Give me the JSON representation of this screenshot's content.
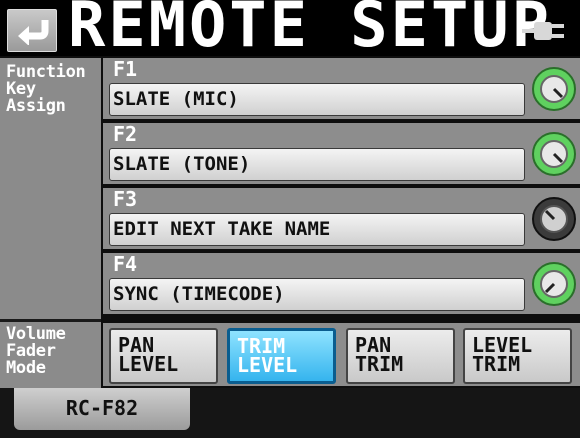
{
  "header": {
    "title": "REMOTE SETUP"
  },
  "function_key_section": {
    "label_lines": [
      "Function",
      "Key",
      "Assign"
    ],
    "keys": [
      {
        "key": "F1",
        "value": "SLATE (MIC)",
        "knob_color": "#5fd15f"
      },
      {
        "key": "F2",
        "value": "SLATE (TONE)",
        "knob_color": "#5fd15f"
      },
      {
        "key": "F3",
        "value": "EDIT NEXT TAKE NAME",
        "knob_color": "#3b3b3b"
      },
      {
        "key": "F4",
        "value": "SYNC (TIMECODE)",
        "knob_color": "#5fd15f"
      }
    ]
  },
  "volume_fader_section": {
    "label_lines": [
      "Volume",
      "Fader",
      "Mode"
    ],
    "buttons": [
      {
        "line1": "PAN",
        "line2": "LEVEL",
        "selected": false
      },
      {
        "line1": "TRIM",
        "line2": "LEVEL",
        "selected": true
      },
      {
        "line1": "PAN",
        "line2": "TRIM",
        "selected": false
      },
      {
        "line1": "LEVEL",
        "line2": "TRIM",
        "selected": false
      }
    ]
  },
  "tabs": [
    {
      "label": "RC-F82",
      "active": true
    }
  ],
  "icons": {
    "back": "return-arrow-icon",
    "power": "ac-plug-icon",
    "knob": "rotary-knob-icon"
  },
  "colors": {
    "accent": "#35b4ee",
    "panel": "#8d8d8d",
    "knob_active": "#5fd15f"
  }
}
